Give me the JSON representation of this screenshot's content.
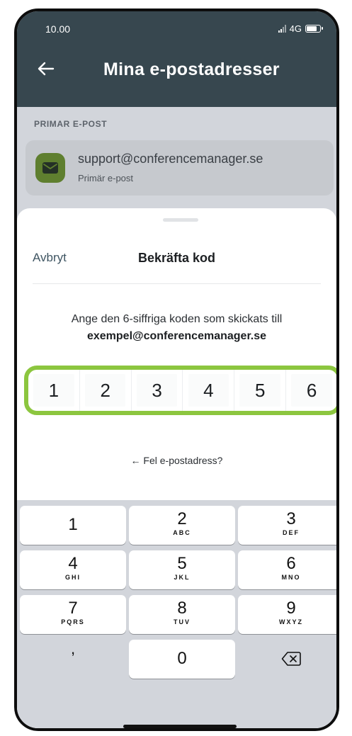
{
  "status_bar": {
    "time": "10.00",
    "network": "4G"
  },
  "header": {
    "title": "Mina e-postadresser"
  },
  "primary_section": {
    "label": "PRIMAR E-POST",
    "email": "support@conferencemanager.se",
    "email_sub": "Primär e-post"
  },
  "sheet": {
    "cancel_label": "Avbryt",
    "title": "Bekräfta kod",
    "instruction": "Ange den 6-siffriga koden som skickats till",
    "target_email": "exempel@conferencemanager.se",
    "code_digits": [
      "1",
      "2",
      "3",
      "4",
      "5",
      "6"
    ],
    "wrong_email_link": "← Fel e-postadress?"
  },
  "keypad": {
    "keys": [
      {
        "num": "1",
        "letters": ""
      },
      {
        "num": "2",
        "letters": "ABC"
      },
      {
        "num": "3",
        "letters": "DEF"
      },
      {
        "num": "4",
        "letters": "GHI"
      },
      {
        "num": "5",
        "letters": "JKL"
      },
      {
        "num": "6",
        "letters": "MNO"
      },
      {
        "num": "7",
        "letters": "PQRS"
      },
      {
        "num": "8",
        "letters": "TUV"
      },
      {
        "num": "9",
        "letters": "WXYZ"
      }
    ],
    "comma": ",",
    "zero": "0"
  },
  "colors": {
    "header_bg": "#37474f",
    "accent_green": "#8cc63f",
    "badge_green": "#5f7f2f"
  }
}
